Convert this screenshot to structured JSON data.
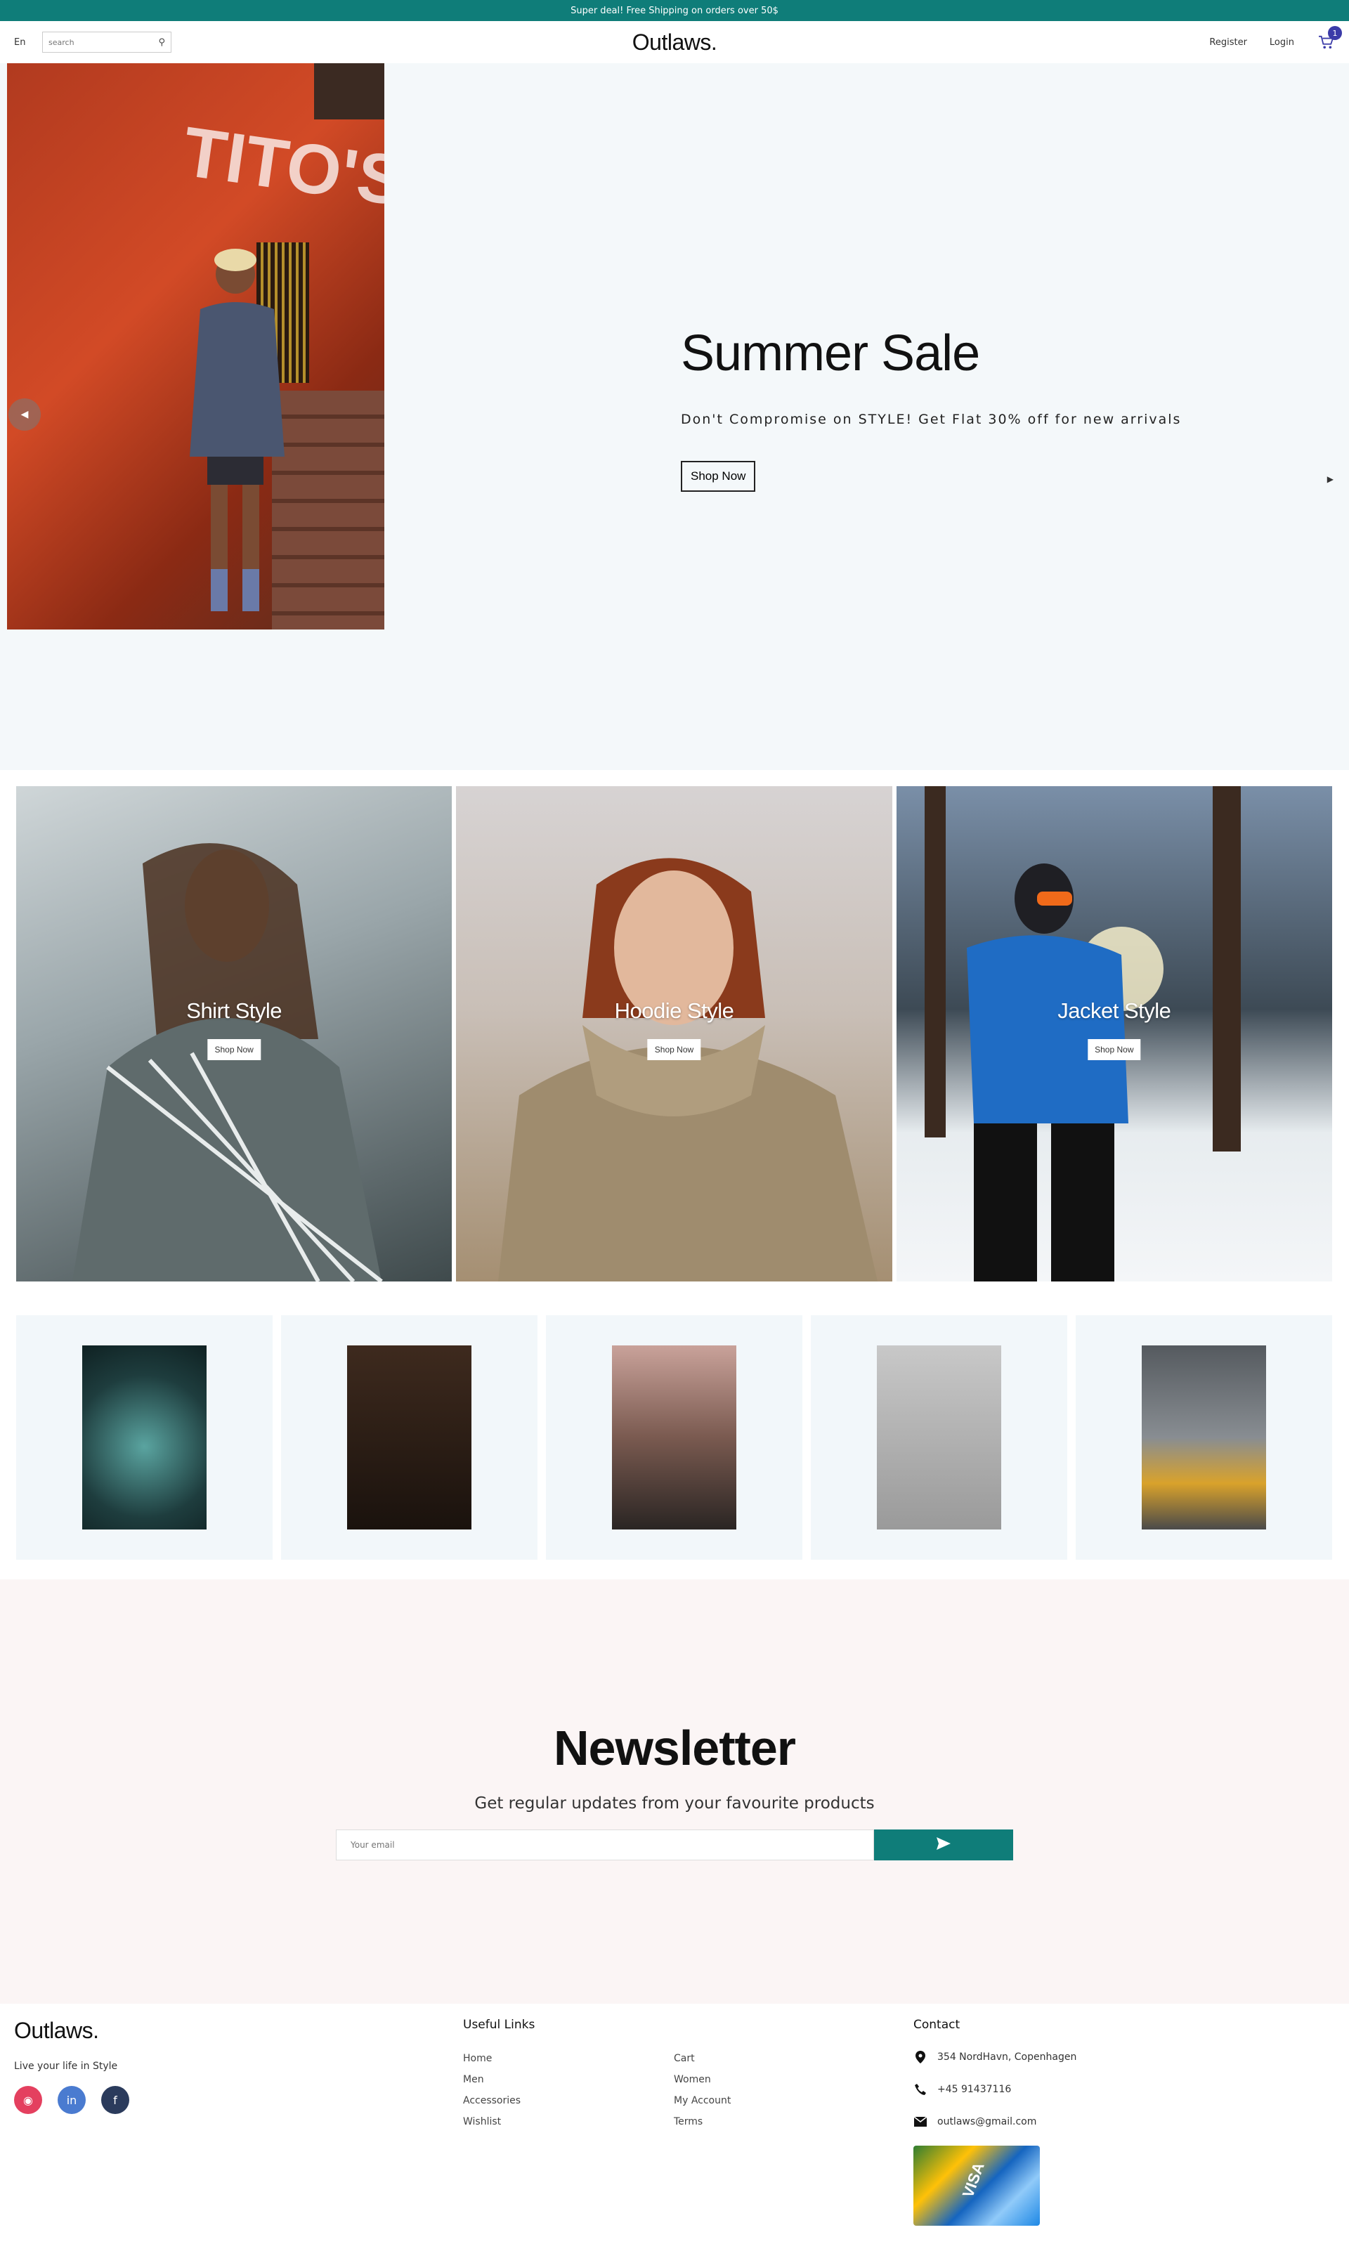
{
  "announcement": "Super deal! Free Shipping on orders over 50$",
  "nav": {
    "language": "En",
    "search_placeholder": "search",
    "logo": "Outlaws.",
    "register": "Register",
    "login": "Login",
    "cart_count": "1"
  },
  "hero": {
    "title": "Summer Sale",
    "subtitle": "Don't Compromise on STYLE! Get Flat 30% off for new arrivals",
    "button": "Shop Now",
    "wall_text": "TITO'S"
  },
  "categories": [
    {
      "title": "Shirt Style",
      "button": "Shop Now"
    },
    {
      "title": "Hoodie Style",
      "button": "Shop Now"
    },
    {
      "title": "Jacket Style",
      "button": "Shop Now"
    }
  ],
  "products": [
    "watch",
    "man-sitting-doorway",
    "man-floral-shirt",
    "sneakers-red",
    "yellow-hoodie"
  ],
  "newsletter": {
    "title": "Newsletter",
    "subtitle": "Get regular updates from your favourite products",
    "placeholder": "Your email",
    "button_icon": "send-icon"
  },
  "footer": {
    "logo": "Outlaws.",
    "tagline": "Live your life in Style",
    "socials": [
      "instagram-icon",
      "linkedin-icon",
      "facebook-icon"
    ],
    "links_title": "Useful Links",
    "links": [
      "Home",
      "Cart",
      "Men",
      "Women",
      "Accessories",
      "My Account",
      "Wishlist",
      "Terms"
    ],
    "contact_title": "Contact",
    "address": "354 NordHavn, Copenhagen",
    "phone": "+45 91437116",
    "email": "outlaws@gmail.com"
  },
  "colors": {
    "brand_teal": "#0f7d79",
    "cart_accent": "#3b3ba8",
    "hero_bg": "#f4f8fa",
    "newsletter_bg": "#fbf5f5"
  }
}
